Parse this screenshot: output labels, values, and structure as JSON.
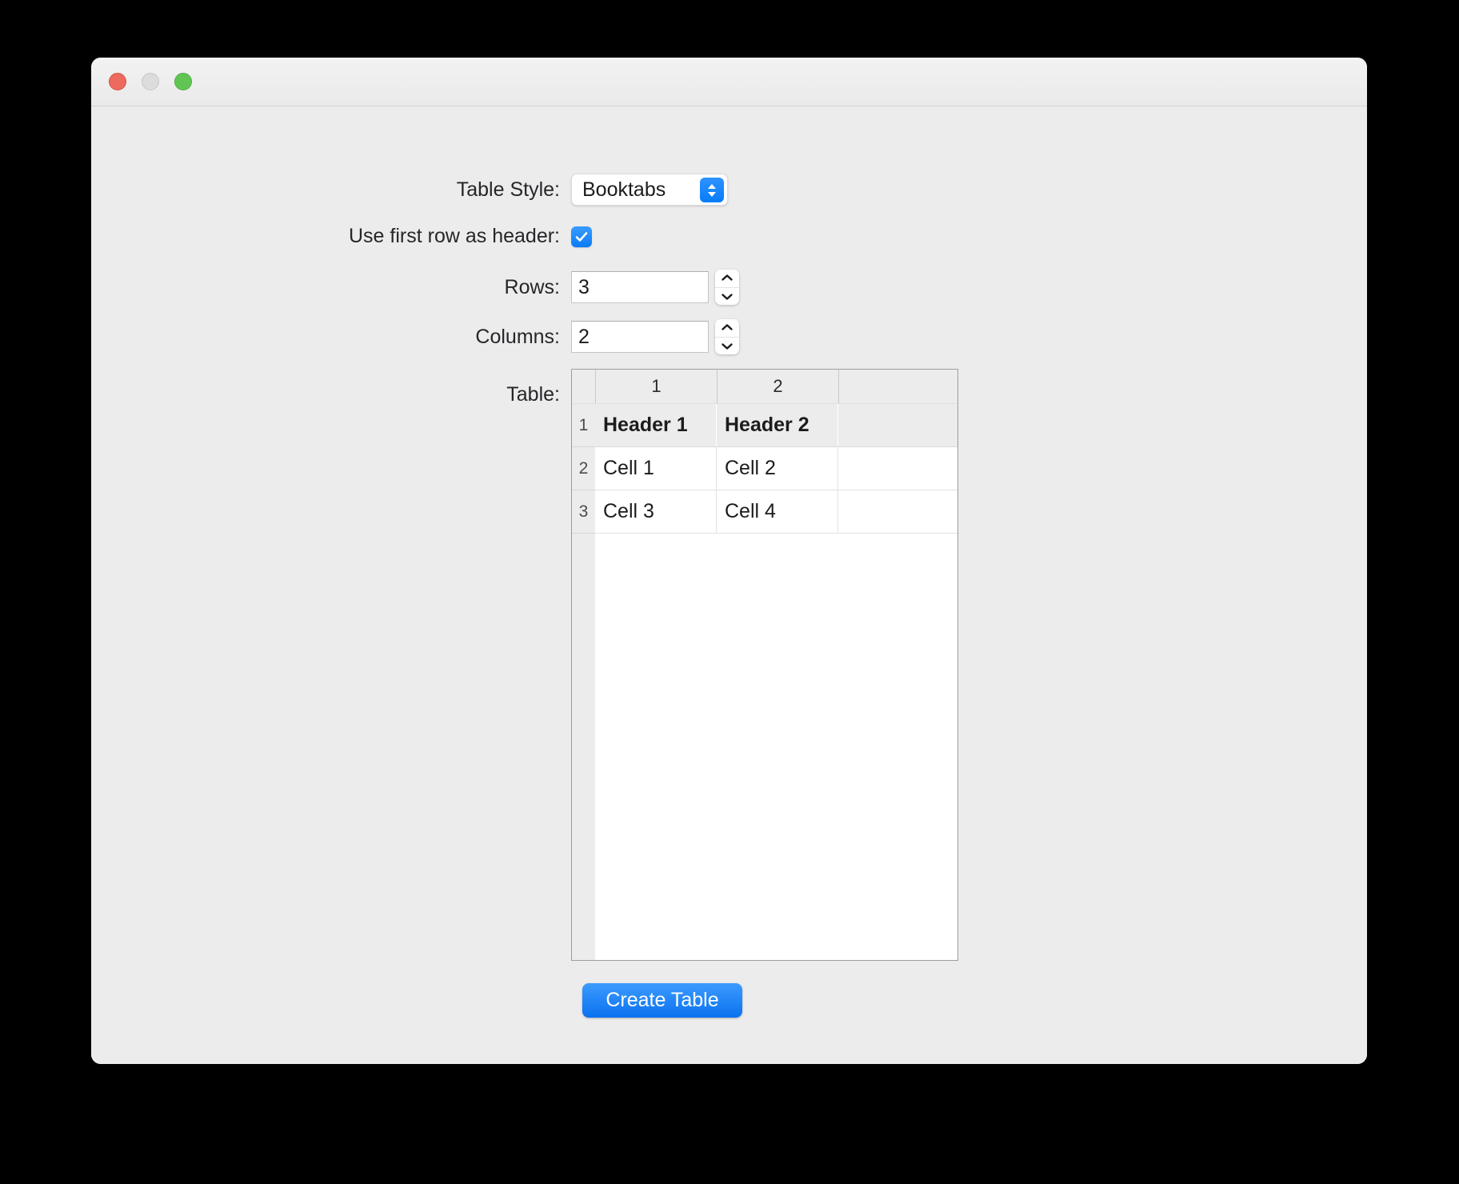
{
  "window": {
    "title": "",
    "traffic_lights": {
      "close_color": "#ED6A5E",
      "minimize_color": "#DCDCDC",
      "maximize_color": "#61C554"
    },
    "accent_color": "#0A7CF7",
    "background_color": "#ECECEC"
  },
  "form": {
    "table_style": {
      "label": "Table Style:",
      "value": "Booktabs",
      "options": [
        "Booktabs"
      ]
    },
    "use_first_row_as_header": {
      "label": "Use first row as header:",
      "checked": true,
      "check_glyph": "checkmark-icon"
    },
    "rows": {
      "label": "Rows:",
      "value": "3"
    },
    "columns": {
      "label": "Columns:",
      "value": "2"
    },
    "table": {
      "label": "Table:",
      "column_headers": [
        "1",
        "2"
      ],
      "row_numbers": [
        "1",
        "2",
        "3"
      ],
      "rows": [
        {
          "is_header": true,
          "cells": [
            "Header 1",
            "Header 2"
          ]
        },
        {
          "is_header": false,
          "cells": [
            "Cell 1",
            "Cell 2"
          ]
        },
        {
          "is_header": false,
          "cells": [
            "Cell 3",
            "Cell 4"
          ]
        }
      ]
    }
  },
  "actions": {
    "create_table": "Create Table"
  }
}
